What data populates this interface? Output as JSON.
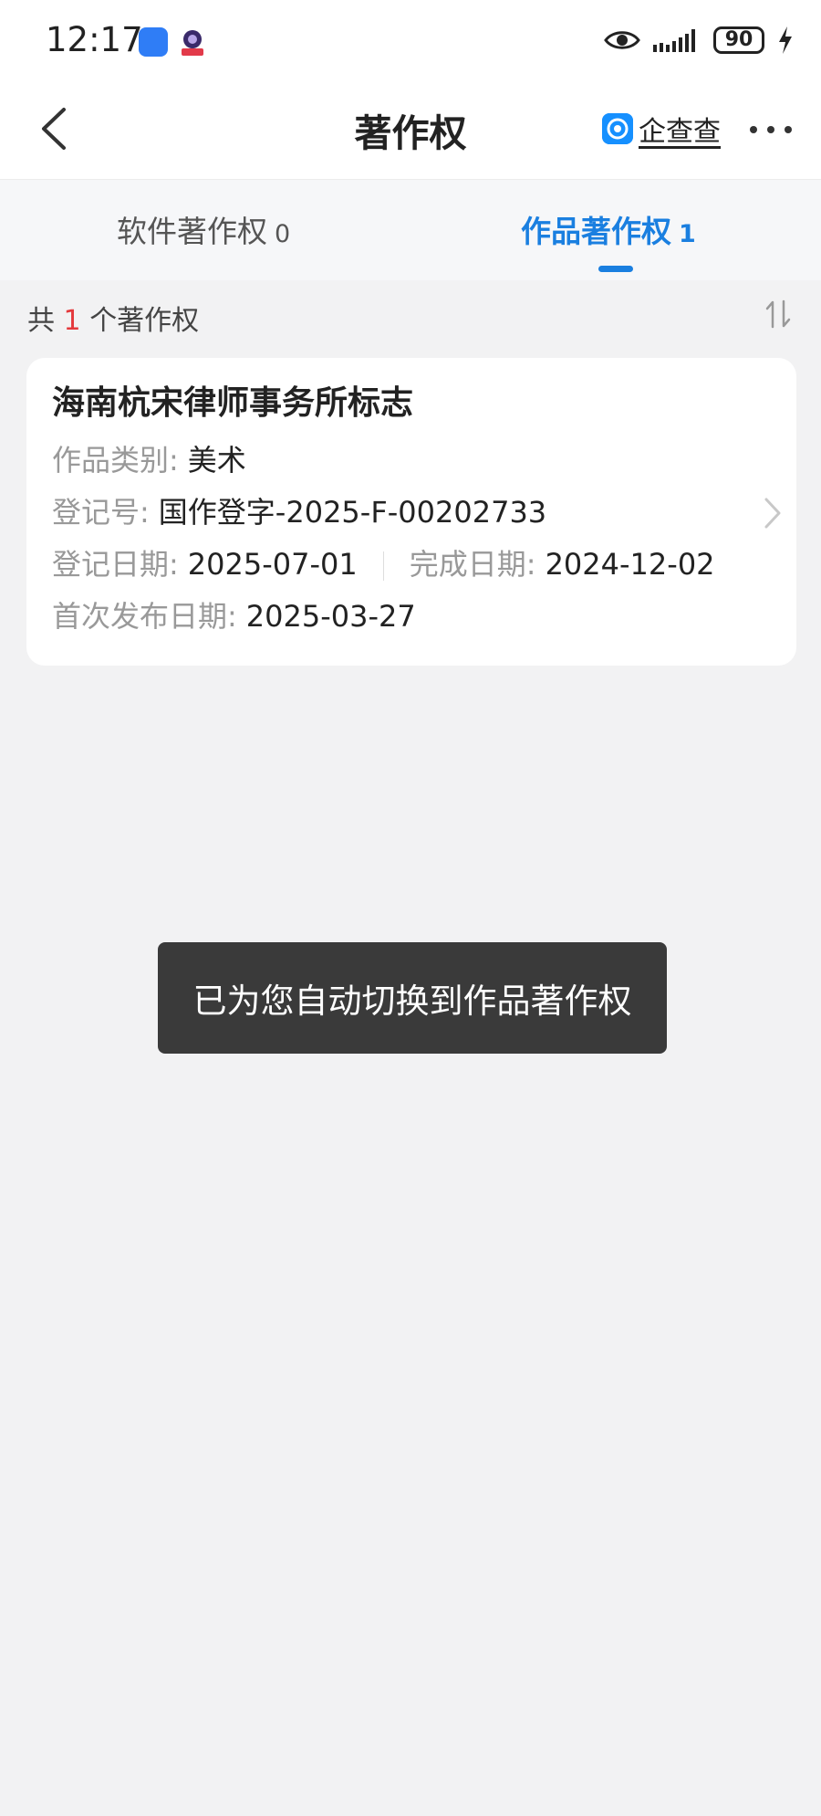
{
  "status_bar": {
    "time": "12:17",
    "battery": "90"
  },
  "header": {
    "title": "著作权",
    "brand": "企查查"
  },
  "tabs": [
    {
      "label": "软件著作权",
      "count": "0"
    },
    {
      "label": "作品著作权",
      "count": "1"
    }
  ],
  "summary": {
    "prefix": "共",
    "count": "1",
    "suffix": "个著作权"
  },
  "record": {
    "title": "海南杭宋律师事务所标志",
    "category_label": "作品类别:",
    "category_value": "美术",
    "reg_no_label": "登记号:",
    "reg_no_value": "国作登字-2025-F-00202733",
    "reg_date_label": "登记日期:",
    "reg_date_value": "2025-07-01",
    "complete_date_label": "完成日期:",
    "complete_date_value": "2024-12-02",
    "publish_date_label": "首次发布日期:",
    "publish_date_value": "2025-03-27"
  },
  "toast": "已为您自动切换到作品著作权",
  "colors": {
    "accent": "#1a7fe0",
    "highlight": "#e4393c",
    "brand": "#1690ff"
  }
}
